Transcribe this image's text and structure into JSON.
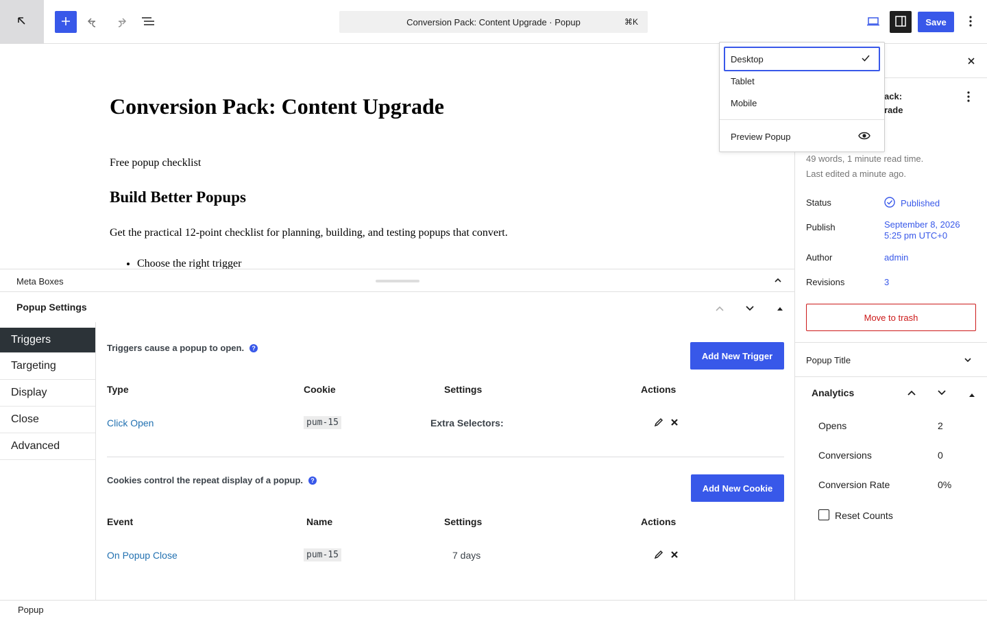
{
  "toolbar": {
    "document_title": "Conversion Pack: Content Upgrade · Popup",
    "shortcut": "⌘K",
    "save_label": "Save"
  },
  "editor": {
    "title": "Conversion Pack: Content Upgrade",
    "paragraph_1": "Free popup checklist",
    "heading_2": "Build Better Popups",
    "paragraph_2": "Get the practical 12-point checklist for planning, building, and testing popups that convert.",
    "list_items": [
      "Choose the right trigger"
    ]
  },
  "meta_boxes": {
    "label": "Meta Boxes",
    "panel_title": "Popup Settings"
  },
  "popup_settings": {
    "tabs": [
      "Triggers",
      "Targeting",
      "Display",
      "Close",
      "Advanced"
    ],
    "active_tab": "Triggers",
    "triggers": {
      "description": "Triggers cause a popup to open.",
      "add_button": "Add New Trigger",
      "columns": [
        "Type",
        "Cookie",
        "Settings",
        "Actions"
      ],
      "rows": [
        {
          "type": "Click Open",
          "cookie": "pum-15",
          "settings": "Extra Selectors:"
        }
      ]
    },
    "cookies": {
      "description": "Cookies control the repeat display of a popup.",
      "add_button": "Add New Cookie",
      "columns": [
        "Event",
        "Name",
        "Settings",
        "Actions"
      ],
      "rows": [
        {
          "event": "On Popup Close",
          "name": "pum-15",
          "settings": "7 days"
        }
      ]
    }
  },
  "footer": {
    "breadcrumb": "Popup"
  },
  "sidebar": {
    "title_line_1": "ack:",
    "title_line_2": "rade",
    "word_count": "49 words, 1 minute read time.",
    "last_edited": "Last edited a minute ago.",
    "rows": {
      "status_label": "Status",
      "status_value": "Published",
      "publish_label": "Publish",
      "publish_value_1": "September 8, 2026",
      "publish_value_2": "5:25 pm UTC+0",
      "author_label": "Author",
      "author_value": "admin",
      "revisions_label": "Revisions",
      "revisions_value": "3"
    },
    "trash_label": "Move to trash",
    "popup_title_section": "Popup Title",
    "analytics": {
      "title": "Analytics",
      "rows": [
        {
          "label": "Opens",
          "value": "2"
        },
        {
          "label": "Conversions",
          "value": "0"
        },
        {
          "label": "Conversion Rate",
          "value": "0%"
        }
      ],
      "reset_label": "Reset Counts"
    }
  },
  "device_menu": {
    "items": [
      "Desktop",
      "Tablet",
      "Mobile"
    ],
    "selected": "Desktop",
    "preview_label": "Preview Popup"
  },
  "colors": {
    "accent": "#3858e9",
    "link": "#2271b1",
    "danger": "#cc1818",
    "active_tab": "#2c3338"
  }
}
